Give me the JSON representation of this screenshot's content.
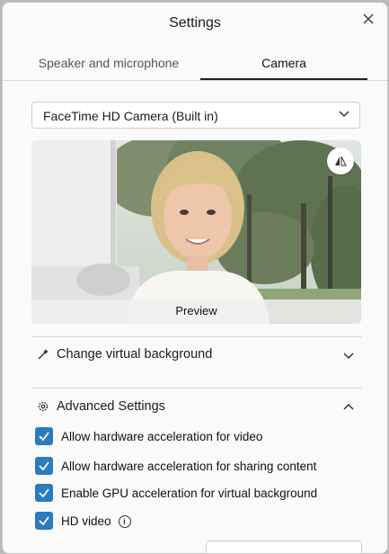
{
  "window": {
    "title": "Settings"
  },
  "tabs": [
    {
      "label": "Speaker and microphone"
    },
    {
      "label": "Camera"
    }
  ],
  "camera_select": {
    "value": "FaceTime HD Camera (Built in)"
  },
  "preview": {
    "label": "Preview"
  },
  "virtual_background": {
    "label": "Change virtual background"
  },
  "advanced": {
    "label": "Advanced Settings",
    "options": [
      {
        "label": "Allow hardware acceleration for video",
        "checked": true
      },
      {
        "label": "Allow hardware acceleration for sharing content",
        "checked": true
      },
      {
        "label": "Enable GPU acceleration for virtual background",
        "checked": true
      },
      {
        "label": "HD video",
        "checked": true
      }
    ]
  },
  "colors": {
    "accent": "#2c7bbd"
  }
}
